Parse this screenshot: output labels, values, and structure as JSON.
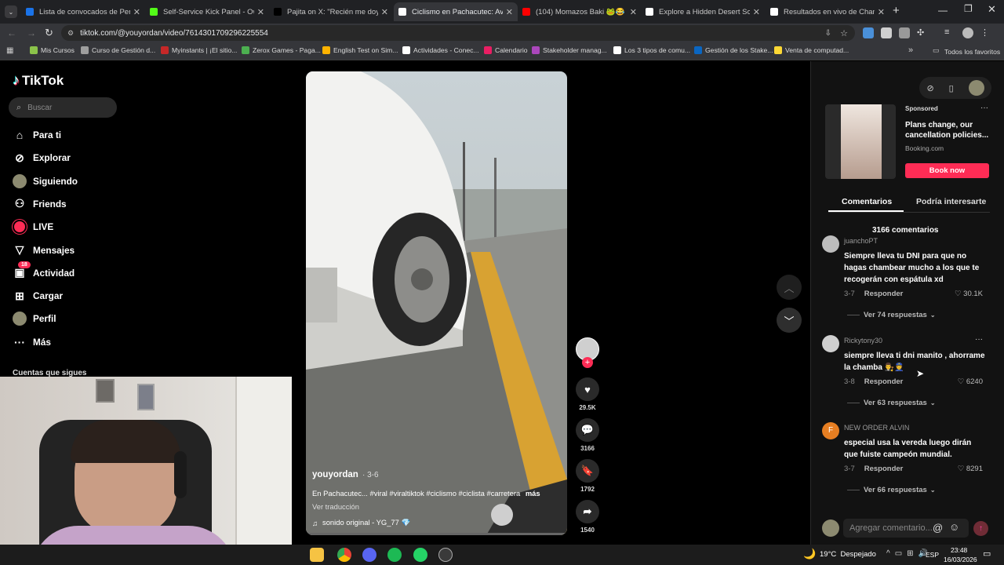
{
  "browser": {
    "tabs": [
      {
        "title": "Lista de convocados de Perú pa",
        "color": "#1a73e8",
        "active": false
      },
      {
        "title": "Self-Service Kick Panel - OwnK",
        "color": "#53fc18",
        "active": false
      },
      {
        "title": "Pajita on X: \"Recién me doy cu",
        "color": "#000000",
        "active": false
      },
      {
        "title": "Ciclismo en Pachacutec: Aventu",
        "color": "#ffffff",
        "active": true
      },
      {
        "title": "(104) Momazos Baki 🐸😂 - He",
        "color": "#ff0000",
        "active": false
      },
      {
        "title": "Explore a Hidden Desert Scorp",
        "color": "#ffffff",
        "active": false
      },
      {
        "title": "Resultados en vivo de Champio",
        "color": "#ffffff",
        "active": false
      }
    ],
    "new_tab": "+",
    "url": "tiktok.com/@youyordan/video/7614301709296225554",
    "bookmarks": [
      {
        "label": "Mis Cursos",
        "color": "#8bc34a"
      },
      {
        "label": "Curso de Gestión d...",
        "color": "#9e9e9e"
      },
      {
        "label": "Myinstants | ¡El sitio...",
        "color": "#c62828"
      },
      {
        "label": "Zerox Games - Paga...",
        "color": "#4caf50"
      },
      {
        "label": "English Test on Sim...",
        "color": "#ffb300"
      },
      {
        "label": "Actividades - Conec...",
        "color": "#ffffff"
      },
      {
        "label": "Calendario",
        "color": "#e91e63"
      },
      {
        "label": "Stakeholder manag...",
        "color": "#ab47bc"
      },
      {
        "label": "Los 3 tipos de comu...",
        "color": "#ffffff"
      },
      {
        "label": "Gestión de los Stake...",
        "color": "#0a66c2"
      },
      {
        "label": "Venta de computad...",
        "color": "#fdd835"
      }
    ],
    "bookmarks_more": "»",
    "all_favorites": "Todos los favoritos"
  },
  "sidebar": {
    "logo": "TikTok",
    "search_placeholder": "Buscar",
    "items": [
      {
        "label": "Para ti",
        "icon": "home-icon"
      },
      {
        "label": "Explorar",
        "icon": "compass-icon"
      },
      {
        "label": "Siguiendo",
        "icon": "avatar"
      },
      {
        "label": "Friends",
        "icon": "friends-icon"
      },
      {
        "label": "LIVE",
        "icon": "live-icon"
      },
      {
        "label": "Mensajes",
        "icon": "send-icon"
      },
      {
        "label": "Actividad",
        "icon": "activity-icon",
        "badge": "18"
      },
      {
        "label": "Cargar",
        "icon": "upload-icon"
      },
      {
        "label": "Perfil",
        "icon": "avatar"
      },
      {
        "label": "Más",
        "icon": "more-icon"
      }
    ],
    "following_heading": "Cuentas que sigues"
  },
  "video": {
    "author": "youyordan",
    "date": "· 3-6",
    "caption": "En Pachacutec... #viral #viraltiktok #ciclismo #ciclista #carretera",
    "more": "más",
    "translate": "Ver traducción",
    "sound": "sonido original - YG_77 💎"
  },
  "actions": {
    "likes": "29.5K",
    "comments": "3166",
    "saves": "1792",
    "shares": "1540"
  },
  "ad": {
    "sponsored": "Sponsored",
    "title": "Plans change, our cancellation policies...",
    "domain": "Booking.com",
    "cta": "Book now",
    "cta_color": "#fe2c55"
  },
  "tabs": {
    "comments": "Comentarios",
    "interesting": "Podría interesarte"
  },
  "comments_count": "3166 comentarios",
  "comments": [
    {
      "user": "juanchoPT",
      "text": "Siempre lleva tu DNI para que no hagas chambear mucho a los que te recogerán con espátula xd",
      "date": "3-7",
      "reply": "Responder",
      "likes": "30.1K",
      "replies": "Ver 74 respuestas"
    },
    {
      "user": "Rickytony30",
      "text": "siempre lleva ti dni manito , ahorrame la chamba 👨‍⚖️👮",
      "date": "3-8",
      "reply": "Responder",
      "likes": "6240",
      "replies": "Ver 63 respuestas"
    },
    {
      "user": "NEW ORDER ALVIN",
      "avatar_letter": "F",
      "text": "especial usa la vereda luego dirán que fuiste campeón mundial.",
      "date": "3-7",
      "reply": "Responder",
      "likes": "8291",
      "replies": "Ver 66 respuestas"
    }
  ],
  "comment_input_placeholder": "Agregar comentario...",
  "taskbar": {
    "weather": "19°C  Despejado",
    "lang": "ESP",
    "time": "23:48",
    "date": "16/03/2026"
  }
}
